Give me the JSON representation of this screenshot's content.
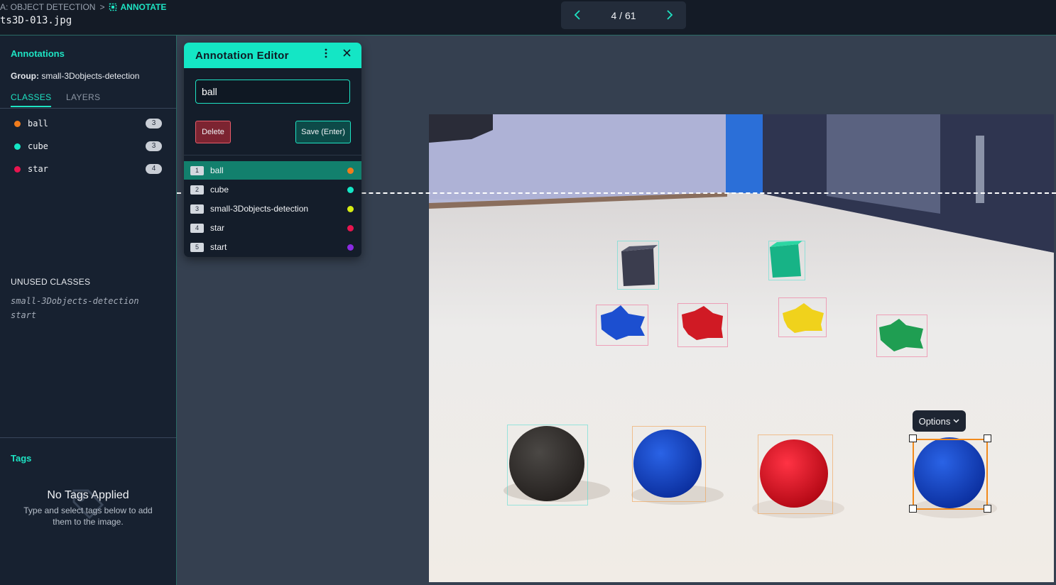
{
  "header": {
    "breadcrumb_parent": "A: OBJECT DETECTION",
    "breadcrumb_separator": ">",
    "breadcrumb_current": "ANNOTATE",
    "filename": "ts3D-013.jpg",
    "pager": {
      "prev_icon": "chevron-left-icon",
      "next_icon": "chevron-right-icon",
      "position": "4 / 61"
    }
  },
  "sidebar": {
    "title": "Annotations",
    "group_label": "Group:",
    "group_value": "small-3Dobjects-detection",
    "tabs": [
      {
        "label": "CLASSES",
        "active": true
      },
      {
        "label": "LAYERS",
        "active": false
      }
    ],
    "classes": [
      {
        "name": "ball",
        "count": "3",
        "color": "#f07c1c"
      },
      {
        "name": "cube",
        "count": "3",
        "color": "#14e6c5"
      },
      {
        "name": "star",
        "count": "4",
        "color": "#e8154f"
      }
    ],
    "unused_title": "UNUSED CLASSES",
    "unused_classes": [
      "small-3Dobjects-detection",
      "start"
    ]
  },
  "tags": {
    "title": "Tags",
    "empty_title": "No Tags Applied",
    "empty_subtitle": "Type and select tags below to add them to the image."
  },
  "editor": {
    "title": "Annotation Editor",
    "menu_icon": "more-vertical-icon",
    "close_icon": "close-icon",
    "input_value": "ball",
    "delete_label": "Delete",
    "save_label": "Save (Enter)",
    "options": [
      {
        "num": "1",
        "label": "ball",
        "color": "#f07c1c",
        "selected": true
      },
      {
        "num": "2",
        "label": "cube",
        "color": "#14e6c5",
        "selected": false
      },
      {
        "num": "3",
        "label": "small-3Dobjects-detection",
        "color": "#d6ec13",
        "selected": false
      },
      {
        "num": "4",
        "label": "star",
        "color": "#e8154f",
        "selected": false
      },
      {
        "num": "5",
        "label": "start",
        "color": "#8a2be2",
        "selected": false
      }
    ]
  },
  "canvas": {
    "options_label": "Options"
  }
}
